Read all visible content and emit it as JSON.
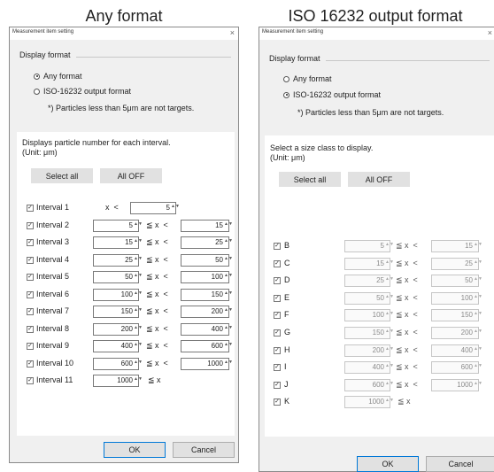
{
  "captions": {
    "left": "Any format",
    "right": "ISO 16232 output format"
  },
  "window_title": "Measurement item setting",
  "close_glyph": "×",
  "display_format_label": "Display format",
  "radio_any_label": "Any format",
  "radio_iso_label": "ISO-16232 output format",
  "particles_note": "*) Particles less than 5μm are not targets.",
  "left_panel": {
    "selected_format": "any",
    "description_line1": "Displays particle number for each interval.",
    "description_line2": "(Unit: μm)",
    "select_all_label": "Select all",
    "all_off_label": "All OFF",
    "rows": [
      {
        "label": "Interval 1",
        "checked": true,
        "lower": "",
        "op1": "x  <",
        "upper": "5",
        "op2": ""
      },
      {
        "label": "Interval 2",
        "checked": true,
        "lower": "5",
        "op1": "≦ x  <",
        "upper": "15"
      },
      {
        "label": "Interval 3",
        "checked": true,
        "lower": "15",
        "op1": "≦ x  <",
        "upper": "25"
      },
      {
        "label": "Interval 4",
        "checked": true,
        "lower": "25",
        "op1": "≦ x  <",
        "upper": "50"
      },
      {
        "label": "Interval 5",
        "checked": true,
        "lower": "50",
        "op1": "≦ x  <",
        "upper": "100"
      },
      {
        "label": "Interval 6",
        "checked": true,
        "lower": "100",
        "op1": "≦ x  <",
        "upper": "150"
      },
      {
        "label": "Interval 7",
        "checked": true,
        "lower": "150",
        "op1": "≦ x  <",
        "upper": "200"
      },
      {
        "label": "Interval 8",
        "checked": true,
        "lower": "200",
        "op1": "≦ x  <",
        "upper": "400"
      },
      {
        "label": "Interval 9",
        "checked": true,
        "lower": "400",
        "op1": "≦ x  <",
        "upper": "600"
      },
      {
        "label": "Interval 10",
        "checked": true,
        "lower": "600",
        "op1": "≦ x  <",
        "upper": "1000"
      },
      {
        "label": "Interval 11",
        "checked": true,
        "lower": "1000",
        "op1": "≦ x",
        "upper": ""
      }
    ],
    "ok_label": "OK",
    "cancel_label": "Cancel"
  },
  "right_panel": {
    "selected_format": "iso",
    "description_line1": "Select a size class to display.",
    "description_line2": "(Unit: μm)",
    "select_all_label": "Select all",
    "all_off_label": "All OFF",
    "rows": [
      {
        "label": "B",
        "checked": true,
        "lower": "5",
        "op1": "≦ x  <",
        "upper": "15"
      },
      {
        "label": "C",
        "checked": true,
        "lower": "15",
        "op1": "≦ x  <",
        "upper": "25"
      },
      {
        "label": "D",
        "checked": true,
        "lower": "25",
        "op1": "≦ x  <",
        "upper": "50"
      },
      {
        "label": "E",
        "checked": true,
        "lower": "50",
        "op1": "≦ x  <",
        "upper": "100"
      },
      {
        "label": "F",
        "checked": true,
        "lower": "100",
        "op1": "≦ x  <",
        "upper": "150"
      },
      {
        "label": "G",
        "checked": true,
        "lower": "150",
        "op1": "≦ x  <",
        "upper": "200"
      },
      {
        "label": "H",
        "checked": true,
        "lower": "200",
        "op1": "≦ x  <",
        "upper": "400"
      },
      {
        "label": "I",
        "checked": true,
        "lower": "400",
        "op1": "≦ x  <",
        "upper": "600"
      },
      {
        "label": "J",
        "checked": true,
        "lower": "600",
        "op1": "≦ x  <",
        "upper": "1000"
      },
      {
        "label": "K",
        "checked": true,
        "lower": "1000",
        "op1": "≦ x",
        "upper": ""
      }
    ],
    "ok_label": "OK",
    "cancel_label": "Cancel"
  },
  "spinner_glyph": "▲▼",
  "check_glyph": "✓"
}
